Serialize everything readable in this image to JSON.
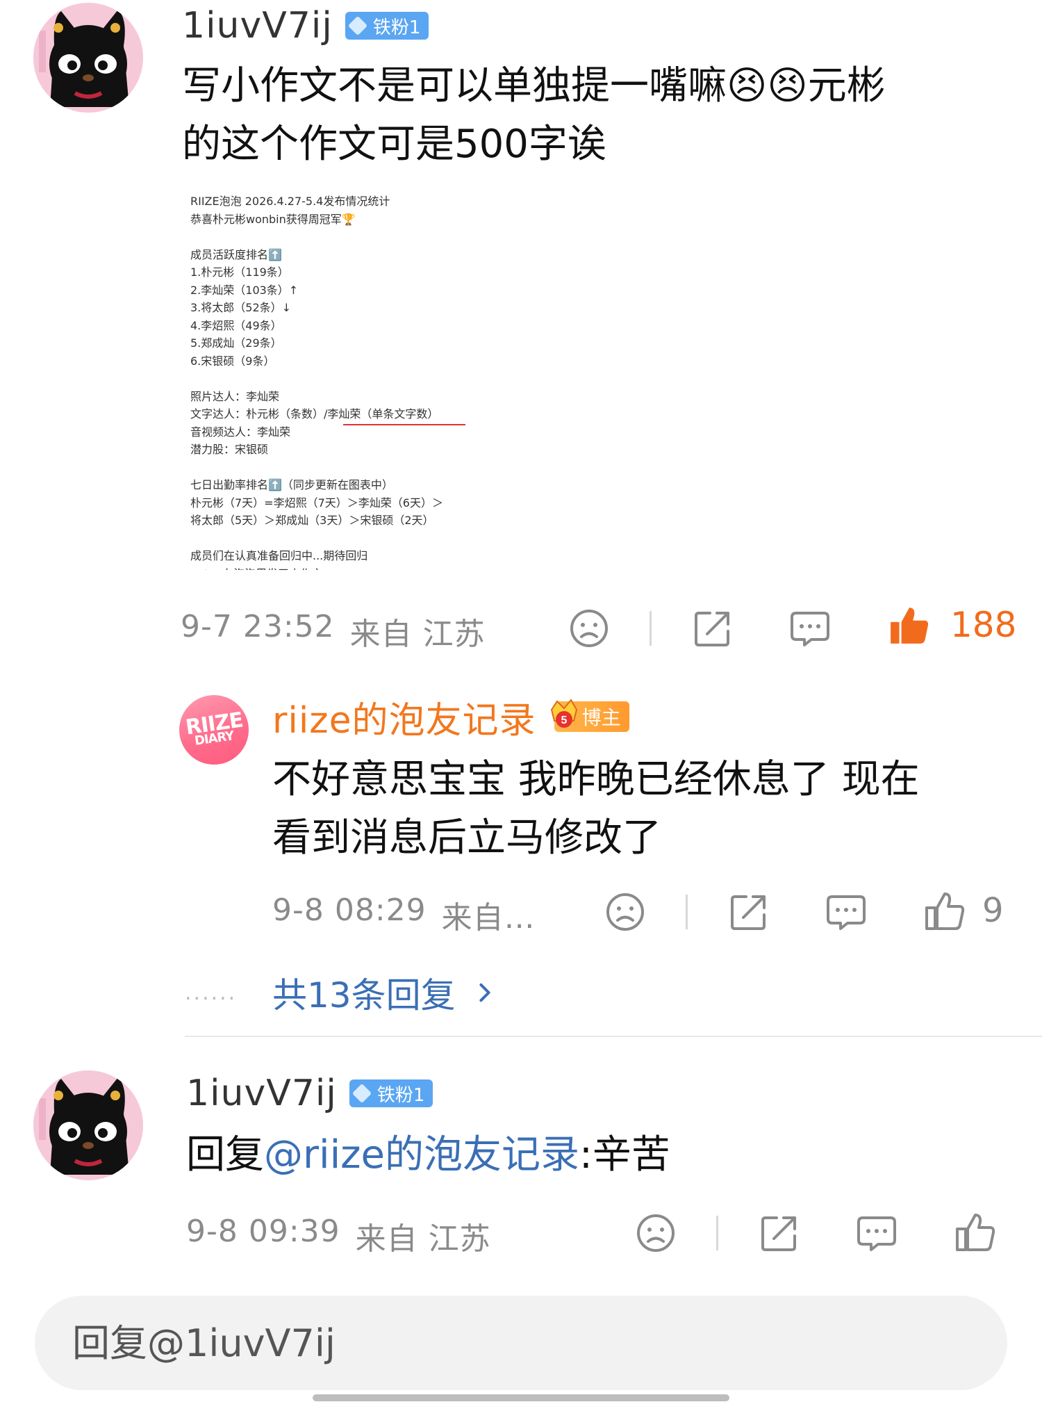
{
  "comment1": {
    "username": "1iuvV7ij",
    "badge": "铁粉1",
    "text_line1": "写小作文不是可以单独提一嘴嘛😣😣元彬",
    "text_line2": "的这个作文可是500字诶",
    "time": "9-7 23:52",
    "from": "来自 江苏",
    "likes": "188",
    "embedded_post": {
      "lines": [
        "RIIZE泡泡 2026.4.27-5.4发布情况统计",
        "恭喜朴元彬wonbin获得周冠军🏆",
        "",
        "成员活跃度排名⬆️",
        "1.朴元彬（119条）",
        "2.李灿荣（103条）↑",
        "3.将太郎（52条）↓",
        "4.李炤熙（49条）",
        "5.郑成灿（29条）",
        "6.宋银硕（9条）",
        "",
        "照片达人：李灿荣",
        "文字达人：朴元彬（条数）/李灿荣（单条文字数）",
        "音视频达人：李灿荣",
        "潜力股：宋银硕",
        "",
        "七日出勤率排名⬆️（同步更新在图表中）",
        "朴元彬（7天）=李炤熙（7天）＞李灿荣（6天）＞",
        "将太郎（5天）＞郑成灿（3天）＞宋银硕（2天）",
        "",
        "成员们在认真准备回归中...期待回归",
        "anton在泡泡里发了小作文～"
      ]
    }
  },
  "reply1": {
    "username": "riize的泡友记录",
    "badge": "博主",
    "avatar_text1": "RIIZE",
    "avatar_text2": "DIARY",
    "text_line1": "不好意思宝宝 我昨晚已经休息了 现在",
    "text_line2": "看到消息后立马修改了",
    "time": "9-8 08:29",
    "from": "来自…",
    "likes": "9",
    "more_replies": "共13条回复",
    "more_dots": "......"
  },
  "comment2": {
    "username": "1iuvV7ij",
    "badge": "铁粉1",
    "reply_prefix": "回复",
    "mention": "@riize的泡友记录",
    "text": ":辛苦",
    "time": "9-8 09:39",
    "from": "来自 江苏"
  },
  "reply_box": {
    "placeholder": "回复@1iuvV7ij"
  },
  "colors": {
    "like_active": "#f26b1d",
    "link": "#3a6fb5",
    "host_name": "#f2771d",
    "fan_badge": "#5aa6f2"
  },
  "icons": [
    "sad-face-icon",
    "share-icon",
    "comment-icon",
    "thumbs-up-icon",
    "chevron-right-icon",
    "crown-icon",
    "diamond-icon"
  ]
}
